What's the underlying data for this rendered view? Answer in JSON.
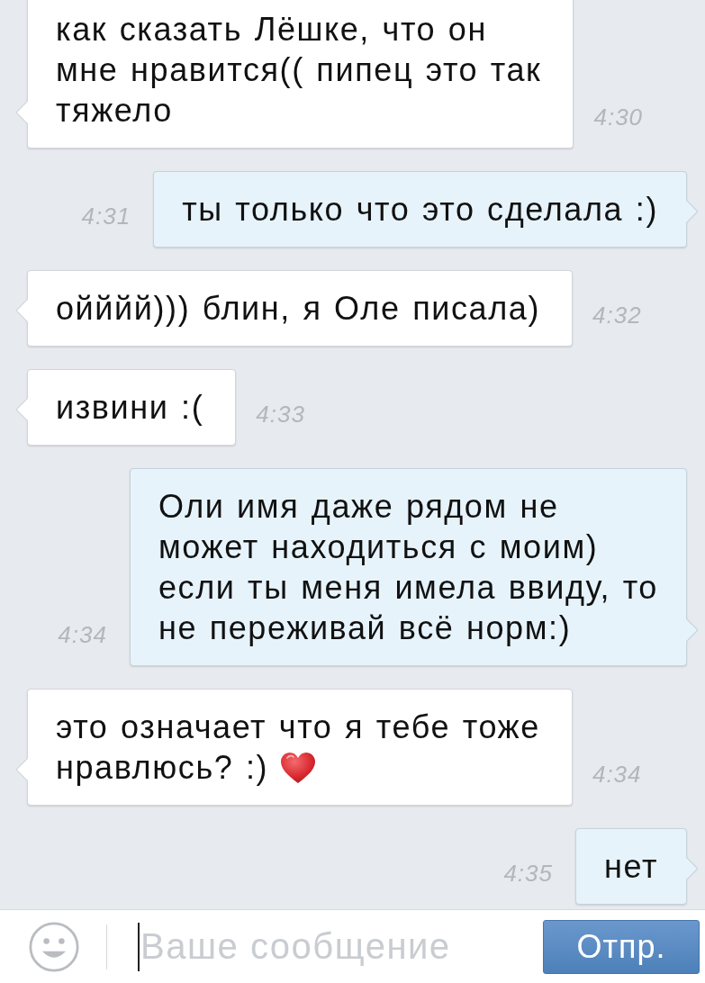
{
  "messages": [
    {
      "outgoing": false,
      "lines": [
        "как сказать Лёшке, что он",
        "мне нравится(( пипец это так",
        "тяжело"
      ],
      "emoji": false,
      "time": "4:30"
    },
    {
      "outgoing": true,
      "lines": [
        "ты только что это сделала :)"
      ],
      "emoji": false,
      "time": "4:31"
    },
    {
      "outgoing": false,
      "lines": [
        "ойййй))) блин, я Оле писала)"
      ],
      "emoji": false,
      "time": "4:32"
    },
    {
      "outgoing": false,
      "lines": [
        "извини :("
      ],
      "emoji": false,
      "time": "4:33"
    },
    {
      "outgoing": true,
      "lines": [
        "Оли имя даже рядом не",
        "может находиться с моим)",
        "если ты меня имела ввиду, то",
        "не переживай всё норм:)"
      ],
      "emoji": false,
      "time": "4:34"
    },
    {
      "outgoing": false,
      "lines": [
        "это означает что я тебе тоже",
        "нравлюсь? :)"
      ],
      "emoji": true,
      "time": "4:34"
    },
    {
      "outgoing": true,
      "lines": [
        "нет"
      ],
      "emoji": false,
      "time": "4:35"
    }
  ],
  "composer": {
    "placeholder": "Ваше сообщение",
    "send_button": "Отпр."
  }
}
